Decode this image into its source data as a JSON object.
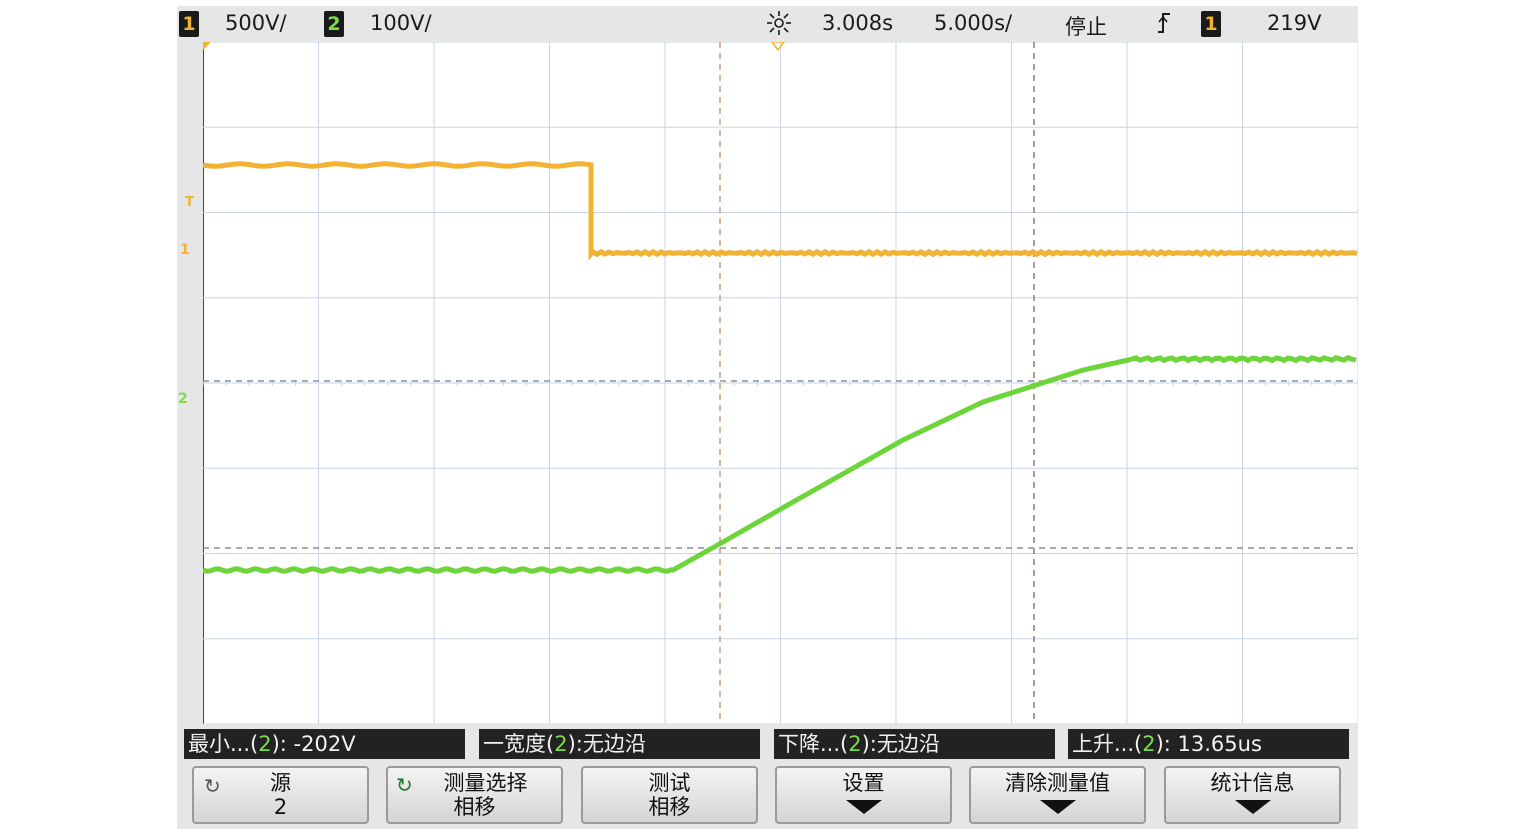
{
  "status": {
    "ch1_num": "1",
    "ch1_scale": "500V/",
    "ch2_num": "2",
    "ch2_scale": "100V/",
    "acq_icon": "acquisition-sun-icon",
    "time_delay": "3.008s",
    "time_scale": "5.000s/",
    "run_state": "停止",
    "trigger_edge_icon": "rising-edge-icon",
    "trigger_ch": "1",
    "trigger_level": "219V"
  },
  "markers": {
    "trigger": "T",
    "ch1": "1",
    "ch2": "2"
  },
  "measurements": [
    {
      "pre": "最小...(",
      "ch": "2",
      "post": "): -202V"
    },
    {
      "pre": "一宽度(",
      "ch": "2",
      "post": "):无边沿"
    },
    {
      "pre": "下降...(",
      "ch": "2",
      "post": "):无边沿"
    },
    {
      "pre": "上升...(",
      "ch": "2",
      "post": "): 13.65us"
    }
  ],
  "softkeys": [
    {
      "line1": "源",
      "line2": "2",
      "icon": "rotate-knob-icon"
    },
    {
      "line1": "测量选择",
      "line2": "相移",
      "icon": "select-knob-icon"
    },
    {
      "line1": "测试",
      "line2": "相移"
    },
    {
      "line1": "设置",
      "icon": "down-arrow-icon"
    },
    {
      "line1": "清除测量值",
      "icon": "down-arrow-icon"
    },
    {
      "line1": "统计信息",
      "icon": "down-arrow-icon"
    }
  ],
  "colors": {
    "ch1": "#f2b233",
    "ch2": "#7ddc4a",
    "grid": "#c9d5e6",
    "cursor_v": "#b8926a",
    "cursor_h": "#8a8a8a"
  }
}
